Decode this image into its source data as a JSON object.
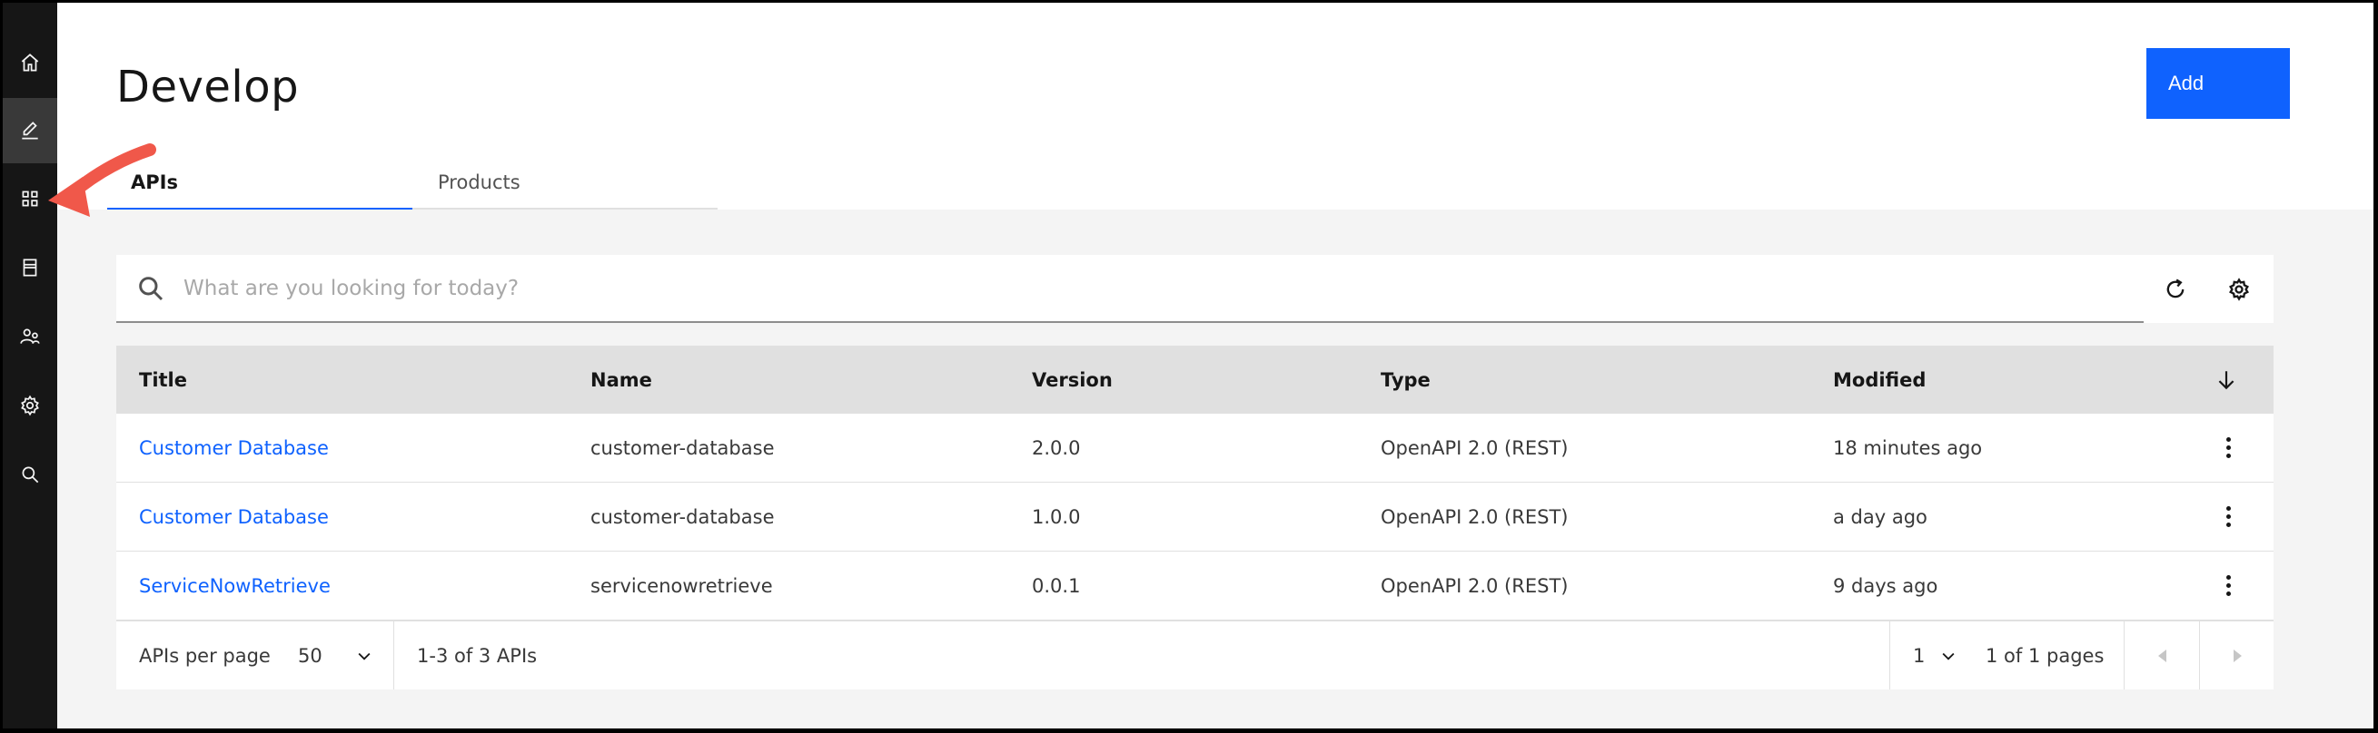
{
  "rail": {
    "items": [
      {
        "name": "home-icon",
        "active": false
      },
      {
        "name": "edit-icon",
        "active": true
      },
      {
        "name": "grid-icon",
        "active": false
      },
      {
        "name": "catalog-icon",
        "active": false
      },
      {
        "name": "users-icon",
        "active": false
      },
      {
        "name": "settings-icon",
        "active": false
      },
      {
        "name": "search-icon",
        "active": false
      }
    ]
  },
  "header": {
    "title": "Develop",
    "add_label": "Add"
  },
  "tabs": [
    {
      "label": "APIs",
      "active": true
    },
    {
      "label": "Products",
      "active": false
    }
  ],
  "search": {
    "placeholder": "What are you looking for today?"
  },
  "table": {
    "columns": [
      "Title",
      "Name",
      "Version",
      "Type",
      "Modified"
    ],
    "rows": [
      {
        "title": "Customer Database",
        "name": "customer-database",
        "version": "2.0.0",
        "type": "OpenAPI 2.0 (REST)",
        "modified": "18 minutes ago"
      },
      {
        "title": "Customer Database",
        "name": "customer-database",
        "version": "1.0.0",
        "type": "OpenAPI 2.0 (REST)",
        "modified": "a day ago"
      },
      {
        "title": "ServiceNowRetrieve",
        "name": "servicenowretrieve",
        "version": "0.0.1",
        "type": "OpenAPI 2.0 (REST)",
        "modified": "9 days ago"
      }
    ]
  },
  "pagination": {
    "per_page_label": "APIs per page",
    "per_page_value": "50",
    "range_text": "1-3 of 3 APIs",
    "page_value": "1",
    "pages_text": "1 of 1 pages"
  },
  "colors": {
    "accent": "#0f62fe",
    "rail": "#161616",
    "annotation": "#f0584a"
  }
}
